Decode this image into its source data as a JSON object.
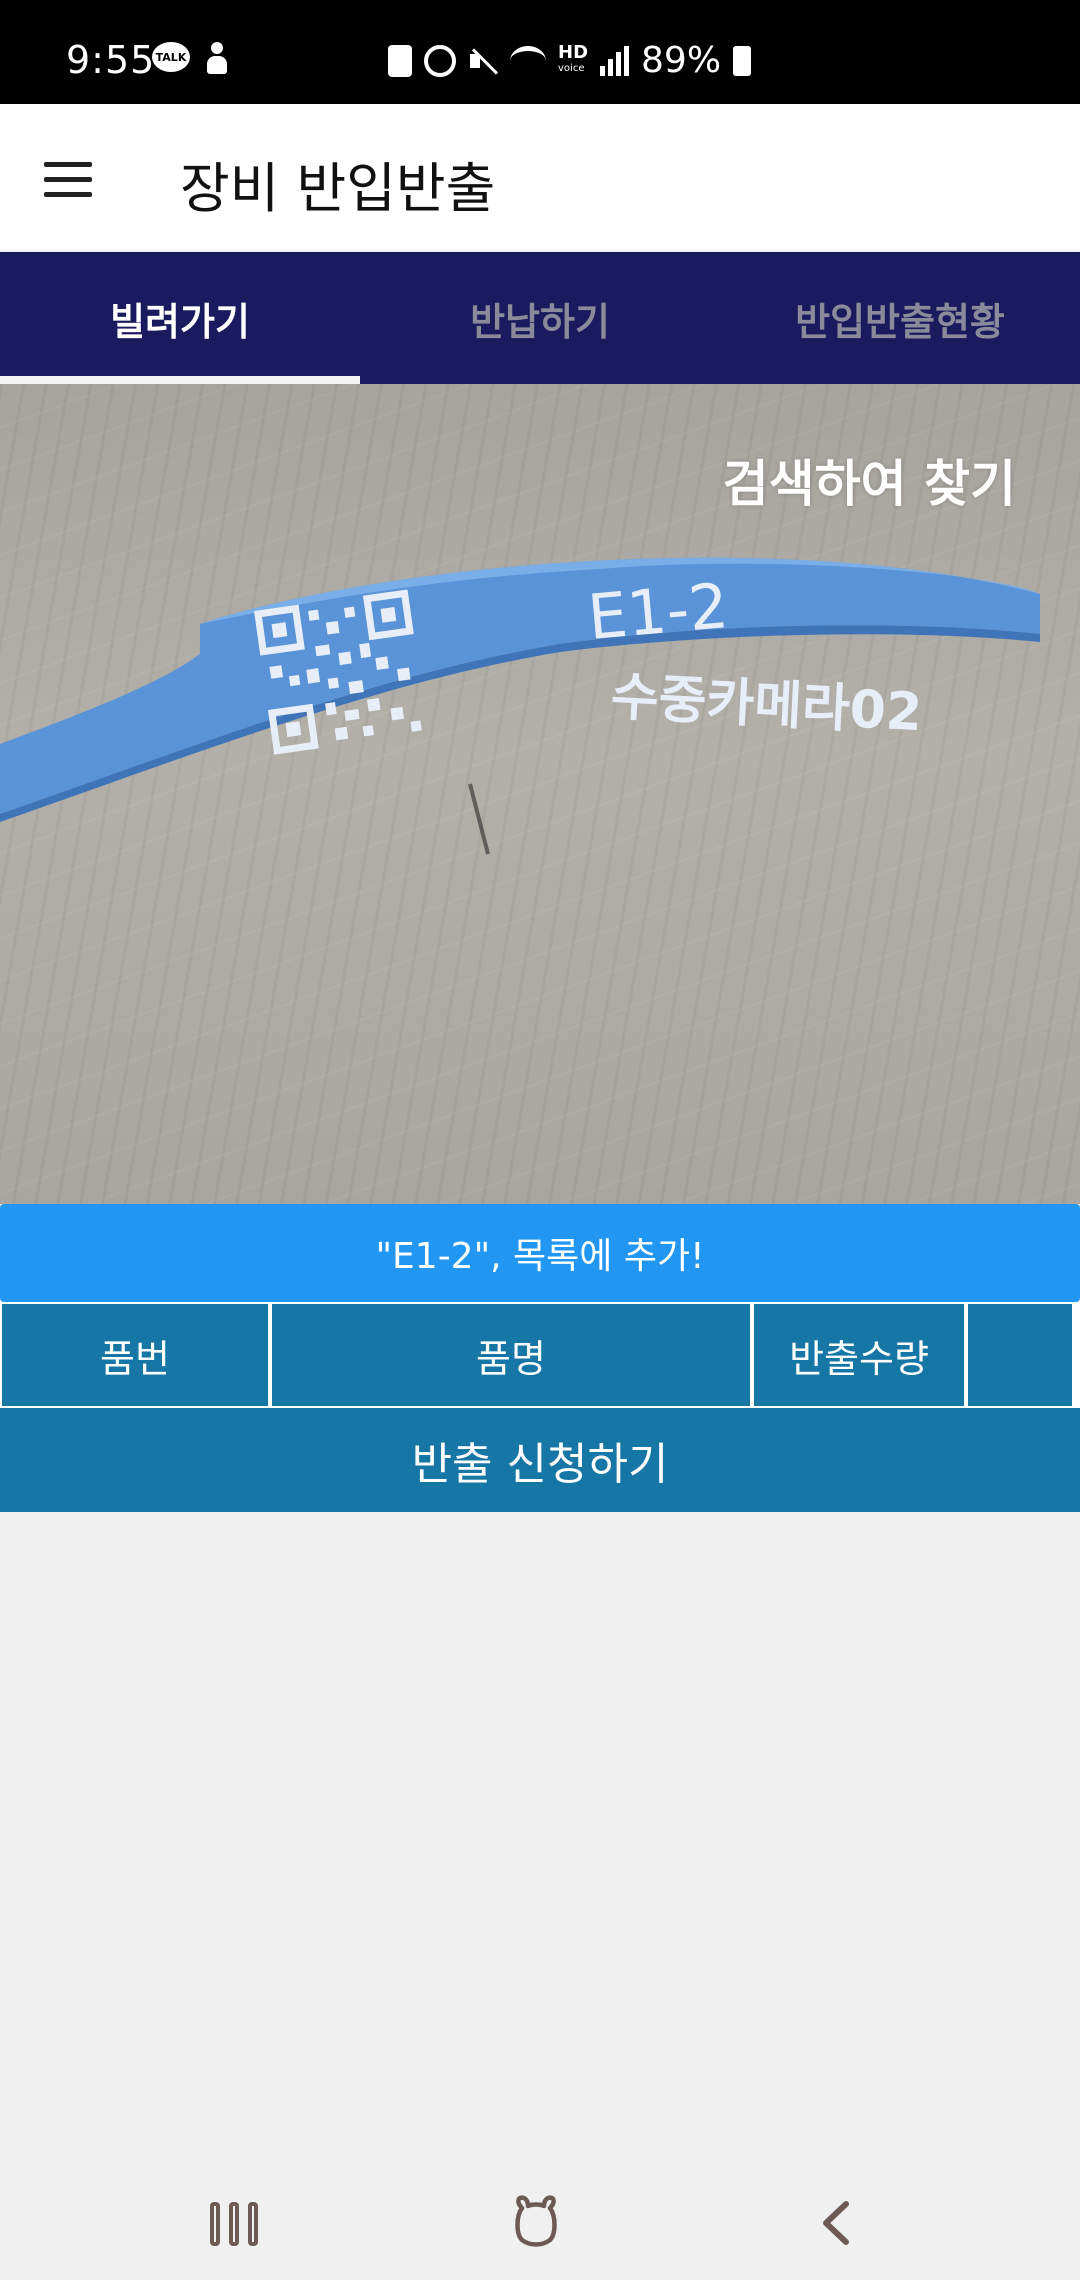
{
  "status_bar": {
    "time": "9:55",
    "talk_icon_text": "TALK",
    "hd_label": "HD",
    "hd_sub": "voice",
    "battery_pct": "89%"
  },
  "header": {
    "title": "장비 반입반출",
    "menu_icon": "hamburger-icon"
  },
  "tabs": [
    {
      "label": "빌려가기",
      "active": true
    },
    {
      "label": "반납하기",
      "active": false
    },
    {
      "label": "반입반출현황",
      "active": false
    }
  ],
  "camera": {
    "search_link": "검색하여 찾기",
    "tag_code": "E1-2",
    "tag_name": "수중카메라02"
  },
  "notice": "\"E1-2\", 목록에 추가!",
  "table": {
    "columns": [
      "품번",
      "품명",
      "반출수량",
      ""
    ]
  },
  "submit_label": "반출 신청하기",
  "colors": {
    "tab_bar": "#1a1a5e",
    "notice_bg": "#2196f3",
    "table_bg": "#1676a6",
    "wristband": "#5a93d8"
  },
  "nav": {
    "recent_icon": "recent-apps-icon",
    "home_icon": "home-icon",
    "back_icon": "back-icon"
  }
}
